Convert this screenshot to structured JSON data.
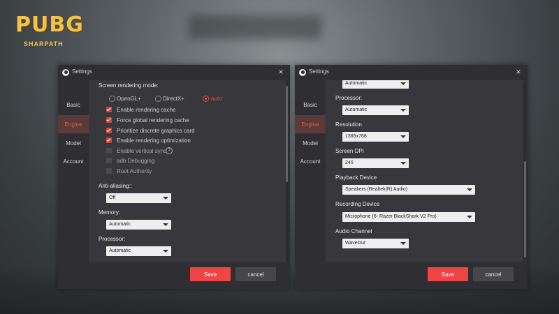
{
  "logo": {
    "main": "PUBG",
    "sub": "SHARPATH"
  },
  "window_title": "Settings",
  "close_glyph": "×",
  "sidebar": [
    "Basic",
    "Engine",
    "Model",
    "Account"
  ],
  "left": {
    "section_rendering": "Screen rendering mode:",
    "modes": [
      {
        "label": "OpenGL+",
        "selected": false
      },
      {
        "label": "DirectX+",
        "selected": false
      },
      {
        "label": "auto",
        "selected": true
      }
    ],
    "options": [
      {
        "label": "Enable rendering cache",
        "checked": true
      },
      {
        "label": "Force global rendering cache",
        "checked": true
      },
      {
        "label": "Prioritize discrete graphics card",
        "checked": true
      },
      {
        "label": "Enable rendering optimization",
        "checked": true
      },
      {
        "label": "Enable vertical sync",
        "checked": false
      },
      {
        "label": "adb Debugging",
        "checked": false
      },
      {
        "label": "Root Authority",
        "checked": false
      }
    ],
    "help_glyph": "?",
    "anti_aliasing_label": "Anti-aliasing::",
    "anti_aliasing_value": "Off",
    "memory_label": "Memory:",
    "memory_value": "Automatic",
    "processor_label": "Processor:",
    "processor_value": "Automatic"
  },
  "right": {
    "memory_value": "Automatic",
    "processor_label": "Processor:",
    "processor_value": "Automatic",
    "resolution_label": "Resolution",
    "resolution_value": "1366x768",
    "dpi_label": "Screen DPI",
    "dpi_value": "240",
    "playback_label": "Playback Device",
    "playback_value": "Speakers (Realtek(R) Audio)",
    "recording_label": "Recording Device",
    "recording_value": "Microphone (6- Razer BlackShark V2 Pro)",
    "audio_channel_label": "Audio Channel",
    "audio_channel_value": "WaveOut"
  },
  "buttons": {
    "save": "Save",
    "cancel": "cancel"
  },
  "colors": {
    "accent": "#f04545",
    "window_bg": "#2f2f33",
    "content_bg": "#38383c"
  }
}
